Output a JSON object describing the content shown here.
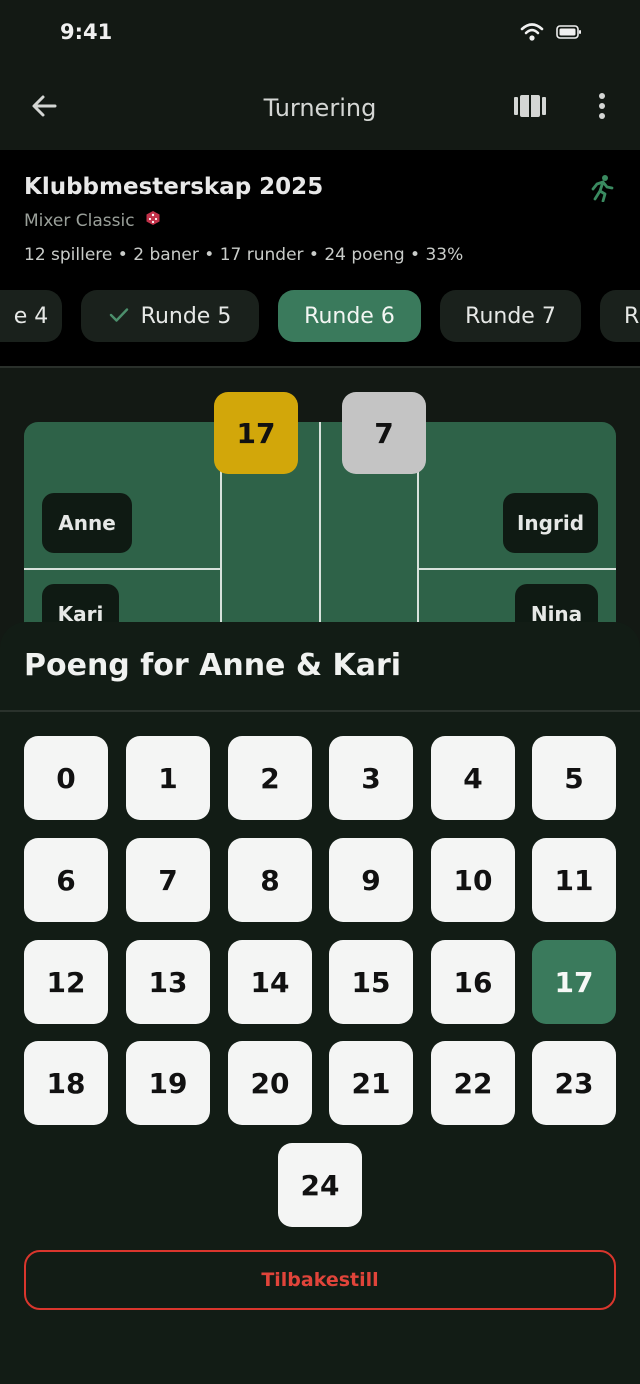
{
  "status": {
    "time": "9:41"
  },
  "app_bar": {
    "title": "Turnering"
  },
  "tournament": {
    "title": "Klubbmesterskap 2025",
    "subtitle": "Mixer Classic",
    "stats": "12 spillere  •  2 baner  •  17 runder  •  24 poeng  •  33%"
  },
  "rounds": [
    {
      "label": "e 4",
      "done": false,
      "active": false
    },
    {
      "label": "Runde 5",
      "done": true,
      "active": false
    },
    {
      "label": "Runde 6",
      "done": false,
      "active": true
    },
    {
      "label": "Runde 7",
      "done": false,
      "active": false
    },
    {
      "label": "R",
      "done": false,
      "active": false
    }
  ],
  "court": {
    "score_left": "17",
    "score_right": "7",
    "score_left_color": "#d2a70a",
    "score_right_color": "#c4c4c4",
    "players": {
      "top_left": "Anne",
      "bottom_left": "Kari",
      "top_right": "Ingrid",
      "bottom_right": "Nina"
    }
  },
  "sheet": {
    "title": "Poeng for Anne & Kari",
    "selected": "17",
    "numbers": [
      "0",
      "1",
      "2",
      "3",
      "4",
      "5",
      "6",
      "7",
      "8",
      "9",
      "10",
      "11",
      "12",
      "13",
      "14",
      "15",
      "16",
      "17",
      "18",
      "19",
      "20",
      "21",
      "22",
      "23",
      "24"
    ],
    "reset_label": "Tilbakestill"
  },
  "colors": {
    "accent": "#3a7a5c",
    "danger": "#d9362d",
    "court": "#2e6248"
  }
}
